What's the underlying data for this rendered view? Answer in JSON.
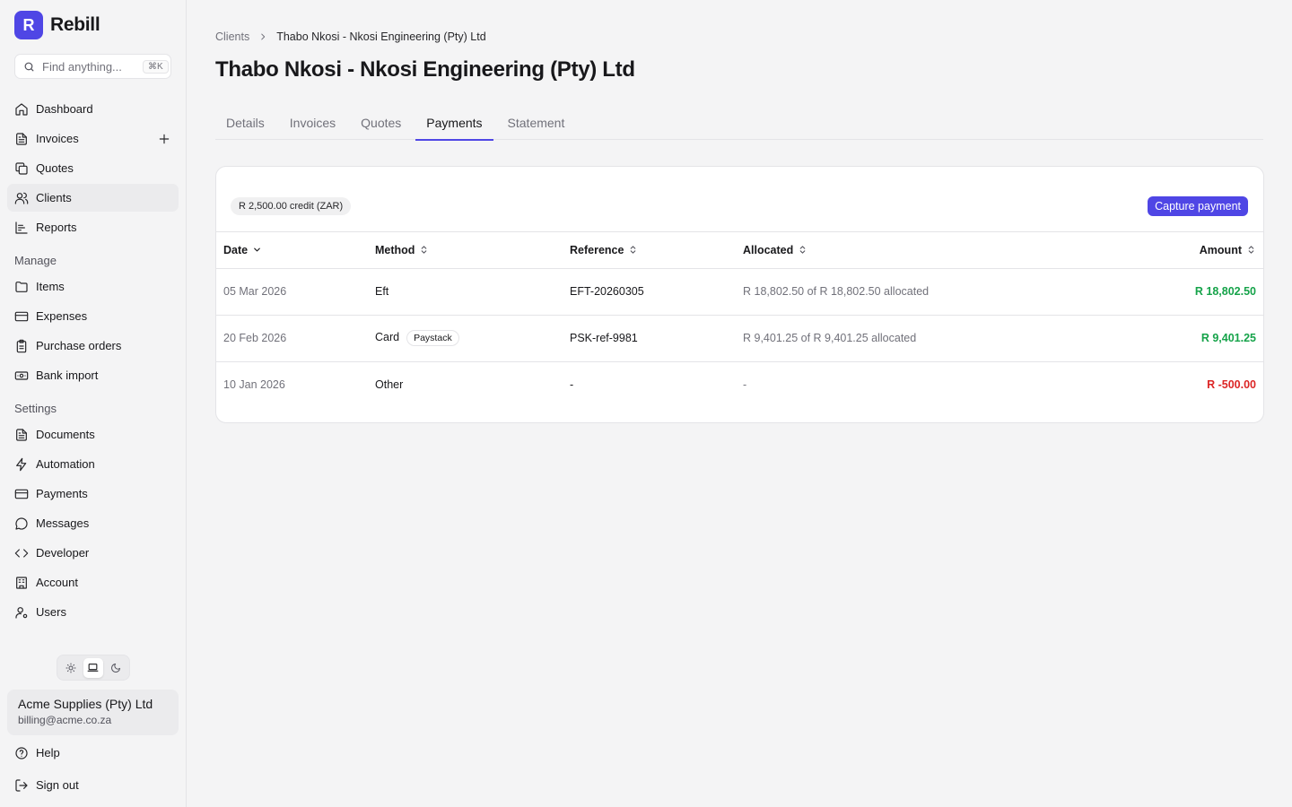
{
  "brand": {
    "logo_letter": "R",
    "name": "Rebill"
  },
  "search": {
    "placeholder": "Find anything...",
    "shortcut": "⌘K"
  },
  "sidebar": {
    "main_items": [
      {
        "label": "Dashboard",
        "icon": "home-icon"
      },
      {
        "label": "Invoices",
        "icon": "file-text-icon"
      },
      {
        "label": "Quotes",
        "icon": "copy-icon"
      },
      {
        "label": "Clients",
        "icon": "users-icon"
      },
      {
        "label": "Reports",
        "icon": "bar-chart-icon"
      }
    ],
    "manage_title": "Manage",
    "manage_items": [
      {
        "label": "Items",
        "icon": "folder-icon"
      },
      {
        "label": "Expenses",
        "icon": "credit-card-icon"
      },
      {
        "label": "Purchase orders",
        "icon": "clipboard-icon"
      },
      {
        "label": "Bank import",
        "icon": "banknote-icon"
      }
    ],
    "settings_title": "Settings",
    "settings_items": [
      {
        "label": "Documents",
        "icon": "file-text-icon"
      },
      {
        "label": "Automation",
        "icon": "zap-icon"
      },
      {
        "label": "Payments",
        "icon": "credit-card-icon"
      },
      {
        "label": "Messages",
        "icon": "message-circle-icon"
      },
      {
        "label": "Developer",
        "icon": "code-icon"
      },
      {
        "label": "Account",
        "icon": "building-icon"
      },
      {
        "label": "Users",
        "icon": "user-cog-icon"
      }
    ],
    "active_item": "Clients"
  },
  "account": {
    "company": "Acme Supplies (Pty) Ltd",
    "email": "billing@acme.co.za"
  },
  "bottom_nav": {
    "help": "Help",
    "sign_out": "Sign out"
  },
  "breadcrumb": {
    "parent": "Clients",
    "current": "Thabo Nkosi - Nkosi Engineering (Pty) Ltd"
  },
  "page": {
    "title": "Thabo Nkosi - Nkosi Engineering (Pty) Ltd"
  },
  "tabs": [
    {
      "label": "Details"
    },
    {
      "label": "Invoices"
    },
    {
      "label": "Quotes"
    },
    {
      "label": "Payments"
    },
    {
      "label": "Statement"
    }
  ],
  "active_tab": "Payments",
  "payments": {
    "credit_badge": "R 2,500.00 credit (ZAR)",
    "capture_label": "Capture payment",
    "columns": {
      "date": "Date",
      "method": "Method",
      "reference": "Reference",
      "allocated": "Allocated",
      "amount": "Amount"
    },
    "rows": [
      {
        "date": "05 Mar 2026",
        "method": "Eft",
        "provider": "",
        "reference": "EFT-20260305",
        "allocated": "R 18,802.50 of R 18,802.50 allocated",
        "amount": "R 18,802.50",
        "sign": "pos"
      },
      {
        "date": "20 Feb 2026",
        "method": "Card",
        "provider": "Paystack",
        "reference": "PSK-ref-9981",
        "allocated": "R 9,401.25 of R 9,401.25 allocated",
        "amount": "R 9,401.25",
        "sign": "pos"
      },
      {
        "date": "10 Jan 2026",
        "method": "Other",
        "provider": "",
        "reference": "-",
        "allocated": "-",
        "amount": "R -500.00",
        "sign": "neg"
      }
    ]
  },
  "colors": {
    "accent": "#4f46e5",
    "positive": "#16a34a",
    "negative": "#dc2626"
  }
}
